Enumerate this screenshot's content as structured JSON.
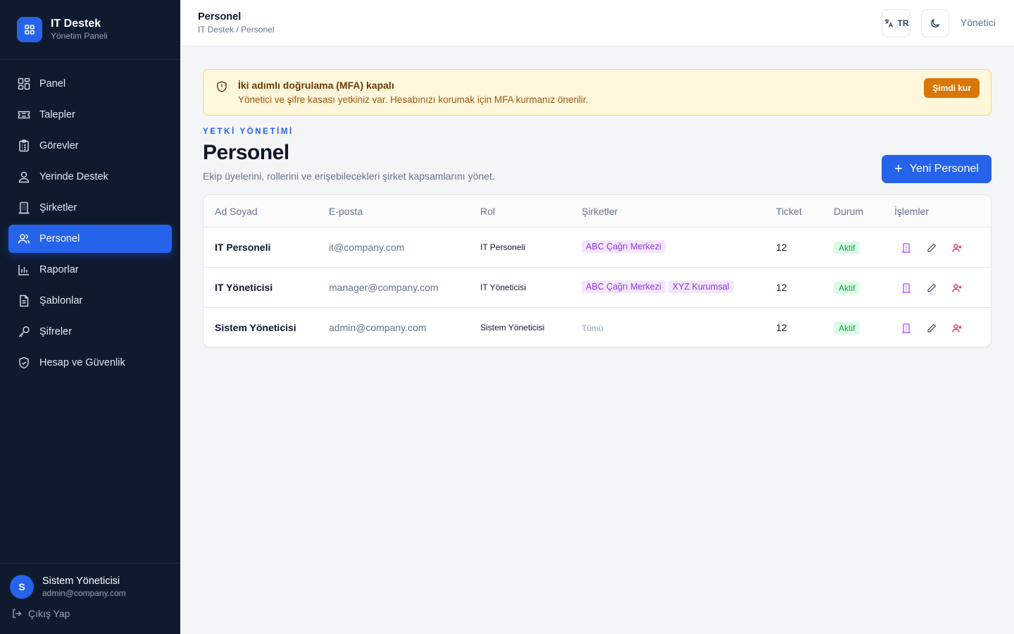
{
  "brand": {
    "title": "IT Destek",
    "subtitle": "Yönetim Paneli",
    "logo_icon": "grid-icon",
    "logo_color": "#2563eb"
  },
  "sidebar": {
    "items": [
      {
        "label": "Panel",
        "icon": "dashboard-icon",
        "active": false
      },
      {
        "label": "Talepler",
        "icon": "ticket-icon",
        "active": false
      },
      {
        "label": "Görevler",
        "icon": "clipboard-list-icon",
        "active": false
      },
      {
        "label": "Yerinde Destek",
        "icon": "user-pin-icon",
        "active": false
      },
      {
        "label": "Şirketler",
        "icon": "building-icon",
        "active": false
      },
      {
        "label": "Personel",
        "icon": "users-icon",
        "active": true
      },
      {
        "label": "Raporlar",
        "icon": "bar-chart-icon",
        "active": false
      },
      {
        "label": "Şablonlar",
        "icon": "file-text-icon",
        "active": false
      },
      {
        "label": "Şifreler",
        "icon": "key-icon",
        "active": false
      },
      {
        "label": "Hesap ve Güvenlik",
        "icon": "shield-check-icon",
        "active": false
      }
    ],
    "user": {
      "initial": "S",
      "name": "Sistem Yöneticisi",
      "email": "admin@company.com"
    },
    "logout_label": "Çıkış Yap"
  },
  "header": {
    "title": "Personel",
    "breadcrumb": "IT Destek / Personel",
    "language": "TR",
    "role": "Yönetici"
  },
  "alert": {
    "title": "İki adımlı doğrulama (MFA) kapalı",
    "message": "Yönetici ve şifre kasası yetkiniz var. Hesabınızı korumak için MFA kurmanız önerilir.",
    "action_label": "Şimdi kur",
    "accent": "#d97706"
  },
  "page": {
    "eyebrow": "YETKİ YÖNETİMİ",
    "title": "Personel",
    "description": "Ekip üyelerini, rollerini ve erişebilecekleri şirket kapsamlarını yönet.",
    "new_button_label": "Yeni Personel"
  },
  "table": {
    "columns": [
      "Ad Soyad",
      "E-posta",
      "Rol",
      "Şirketler",
      "Ticket",
      "Durum",
      "İşlemler"
    ],
    "rows": [
      {
        "name": "IT Personeli",
        "email": "it@company.com",
        "role": "IT Personeli",
        "companies": [
          "ABC Çağrı Merkezi"
        ],
        "companies_text": "",
        "tickets": "12",
        "status": "Aktif"
      },
      {
        "name": "IT Yöneticisi",
        "email": "manager@company.com",
        "role": "IT Yöneticisi",
        "companies": [
          "ABC Çağrı Merkezi",
          "XYZ Kurumsal"
        ],
        "companies_text": "",
        "tickets": "12",
        "status": "Aktif"
      },
      {
        "name": "Sistem Yöneticisi",
        "email": "admin@company.com",
        "role": "Sistem Yöneticisi",
        "companies": [],
        "companies_text": "Tümü",
        "tickets": "12",
        "status": "Aktif"
      }
    ],
    "row_actions": [
      "companies-icon",
      "edit-icon",
      "remove-user-icon"
    ]
  }
}
